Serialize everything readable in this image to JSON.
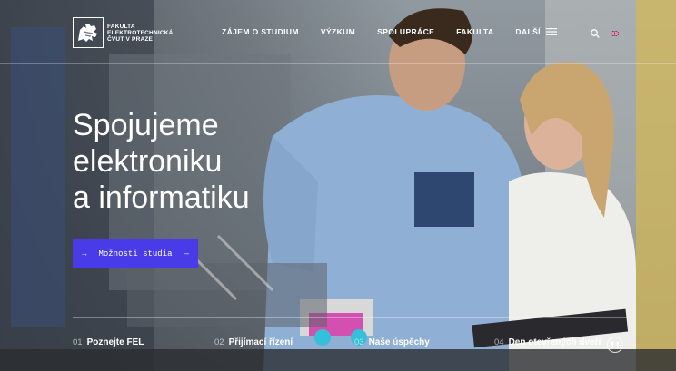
{
  "brand": {
    "line1": "FAKULTA",
    "line2": "ELEKTROTECHNICKÁ",
    "line3": "ČVUT V PRAZE"
  },
  "nav": {
    "items": [
      {
        "label": "ZÁJEM O STUDIUM"
      },
      {
        "label": "VÝZKUM"
      },
      {
        "label": "SPOLUPRÁCE"
      },
      {
        "label": "FAKULTA"
      },
      {
        "label": "DALŠÍ"
      }
    ],
    "menu_icon": "hamburger-icon",
    "search_icon": "search-icon",
    "language_icon": "uk-flag-icon"
  },
  "hero": {
    "headline": [
      "Spojujeme",
      "elektroniku",
      "a informatiku"
    ],
    "cta_label": "Možnosti studia",
    "cta_color": "#4a3be8"
  },
  "tabs": [
    {
      "num": "01",
      "label": "Poznejte FEL"
    },
    {
      "num": "02",
      "label": "Přijímací řízení"
    },
    {
      "num": "03",
      "label": "Naše úspěchy"
    },
    {
      "num": "04",
      "label": "Den otevřených dveří"
    }
  ],
  "pause_icon": "pause-icon"
}
